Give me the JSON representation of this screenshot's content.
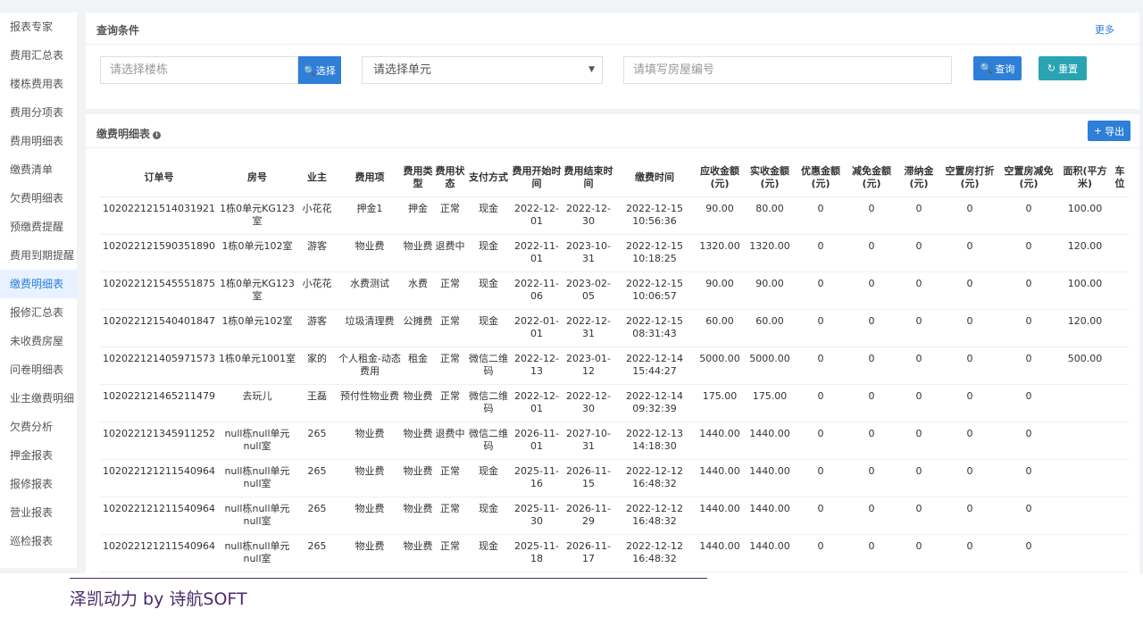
{
  "sidebar": {
    "items": [
      {
        "label": "报表专家"
      },
      {
        "label": "费用汇总表"
      },
      {
        "label": "楼栋费用表"
      },
      {
        "label": "费用分项表"
      },
      {
        "label": "费用明细表"
      },
      {
        "label": "缴费清单"
      },
      {
        "label": "欠费明细表"
      },
      {
        "label": "预缴费提醒"
      },
      {
        "label": "费用到期提醒"
      },
      {
        "label": "缴费明细表"
      },
      {
        "label": "报修汇总表"
      },
      {
        "label": "未收费房屋"
      },
      {
        "label": "问卷明细表"
      },
      {
        "label": "业主缴费明细"
      },
      {
        "label": "欠费分析"
      },
      {
        "label": "押金报表"
      },
      {
        "label": "报修报表"
      },
      {
        "label": "营业报表"
      },
      {
        "label": "巡检报表"
      }
    ],
    "active_index": 9
  },
  "query": {
    "title": "查询条件",
    "more": "更多",
    "building_placeholder": "请选择楼栋",
    "select_button": "选择",
    "unit_select_value": "请选择单元",
    "house_placeholder": "请填写房屋编号",
    "query_button": "查询",
    "reset_button": "重置"
  },
  "table": {
    "title": "缴费明细表",
    "export_button": "导出",
    "columns": [
      "订单号",
      "房号",
      "业主",
      "费用项",
      "费用类型",
      "费用状态",
      "支付方式",
      "费用开始时间",
      "费用结束时间",
      "缴费时间",
      "应收金额(元)",
      "实收金额(元)",
      "优惠金额(元)",
      "减免金额(元)",
      "滞纳金(元)",
      "空置房打折(元)",
      "空置房减免(元)",
      "面积(平方米)",
      "车位"
    ],
    "rows": [
      [
        "102022121514031921",
        "1栋0单元KG123室",
        "小花花",
        "押金1",
        "押金",
        "正常",
        "现金",
        "2022-12-01",
        "2022-12-30",
        "2022-12-15 10:56:36",
        "90.00",
        "80.00",
        "0",
        "0",
        "0",
        "0",
        "0",
        "100.00",
        ""
      ],
      [
        "102022121590351890",
        "1栋0单元102室",
        "游客",
        "物业费",
        "物业费",
        "退费中",
        "现金",
        "2022-11-01",
        "2023-10-31",
        "2022-12-15 10:18:25",
        "1320.00",
        "1320.00",
        "0",
        "0",
        "0",
        "0",
        "0",
        "120.00",
        ""
      ],
      [
        "102022121545551875",
        "1栋0单元KG123室",
        "小花花",
        "水费测试",
        "水费",
        "正常",
        "现金",
        "2022-11-06",
        "2023-02-05",
        "2022-12-15 10:06:57",
        "90.00",
        "90.00",
        "0",
        "0",
        "0",
        "0",
        "0",
        "100.00",
        ""
      ],
      [
        "102022121540401847",
        "1栋0单元102室",
        "游客",
        "垃圾清理费",
        "公摊费",
        "正常",
        "现金",
        "2022-01-01",
        "2022-12-31",
        "2022-12-15 08:31:43",
        "60.00",
        "60.00",
        "0",
        "0",
        "0",
        "0",
        "0",
        "120.00",
        ""
      ],
      [
        "102022121405971573",
        "1栋0单元1001室",
        "家的",
        "个人租金-动态费用",
        "租金",
        "正常",
        "微信二维码",
        "2022-12-13",
        "2023-01-12",
        "2022-12-14 15:44:27",
        "5000.00",
        "5000.00",
        "0",
        "0",
        "0",
        "0",
        "0",
        "500.00",
        ""
      ],
      [
        "102022121465211479",
        "去玩儿",
        "王磊",
        "预付性物业费",
        "物业费",
        "正常",
        "微信二维码",
        "2022-12-01",
        "2022-12-30",
        "2022-12-14 09:32:39",
        "175.00",
        "175.00",
        "0",
        "0",
        "0",
        "0",
        "0",
        "",
        ""
      ],
      [
        "102022121345911252",
        "null栋null单元null室",
        "265",
        "物业费",
        "物业费",
        "退费中",
        "微信二维码",
        "2026-11-01",
        "2027-10-31",
        "2022-12-13 14:18:30",
        "1440.00",
        "1440.00",
        "0",
        "0",
        "0",
        "0",
        "0",
        "",
        ""
      ],
      [
        "102022121211540964",
        "null栋null单元null室",
        "265",
        "物业费",
        "物业费",
        "正常",
        "现金",
        "2025-11-16",
        "2026-11-15",
        "2022-12-12 16:48:32",
        "1440.00",
        "1440.00",
        "0",
        "0",
        "0",
        "0",
        "0",
        "",
        ""
      ],
      [
        "102022121211540964",
        "null栋null单元null室",
        "265",
        "物业费",
        "物业费",
        "正常",
        "现金",
        "2025-11-30",
        "2026-11-29",
        "2022-12-12 16:48:32",
        "1440.00",
        "1440.00",
        "0",
        "0",
        "0",
        "0",
        "0",
        "",
        ""
      ],
      [
        "102022121211540964",
        "null栋null单元null室",
        "265",
        "物业费",
        "物业费",
        "正常",
        "现金",
        "2025-11-18",
        "2026-11-17",
        "2022-12-12 16:48:32",
        "1440.00",
        "1440.00",
        "0",
        "0",
        "0",
        "0",
        "0",
        "",
        ""
      ]
    ]
  },
  "footer": {
    "text": "泽凯动力 by 诗航SOFT"
  },
  "colors": {
    "primary": "#2d7fd8",
    "reset": "#2aa3b3",
    "footer": "#4b2a6a"
  }
}
